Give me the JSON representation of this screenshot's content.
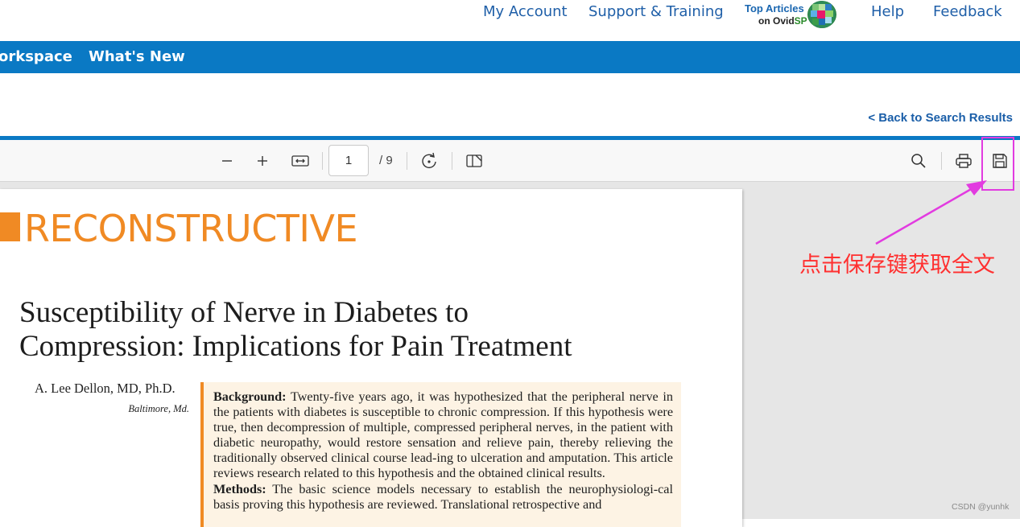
{
  "header": {
    "links": {
      "my_account": "My Account",
      "support": "Support & Training",
      "help": "Help",
      "feedback": "Feedback"
    },
    "promo": {
      "line1": "Top Articles",
      "line2_prefix": "on Ovid",
      "line2_suffix": "SP"
    }
  },
  "nav": {
    "items": [
      "orkspace",
      "What's New"
    ]
  },
  "back_link": "< Back to Search Results",
  "viewer": {
    "toolbar": {
      "zoom_out_icon": "minus-icon",
      "zoom_in_icon": "plus-icon",
      "fit_width_icon": "fit-width-icon",
      "current_page": "1",
      "page_total": "/ 9",
      "rotate_icon": "rotate-icon",
      "page_view_icon": "page-view-icon",
      "search_icon": "search-icon",
      "print_icon": "print-icon",
      "save_icon": "save-icon"
    },
    "page": {
      "section": "RECONSTRUCTIVE",
      "title_line1": "Susceptibility of Nerve in Diabetes to",
      "title_line2": "Compression: Implications for Pain Treatment",
      "author": "A. Lee Dellon, MD, Ph.D.",
      "location": "Baltimore, Md.",
      "abstract": {
        "background_label": "Background:",
        "background_text": " Twenty-five years ago, it was hypothesized that the peripheral nerve in the patients with diabetes is susceptible to chronic compression. If this hypothesis were true, then decompression of multiple, compressed peripheral nerves, in the patient with diabetic neuropathy, would restore sensation and relieve pain, thereby relieving the traditionally observed clinical course lead-ing to ulceration and amputation. This article reviews research related to this hypothesis and the obtained clinical results.",
        "methods_label": "Methods:",
        "methods_text": " The basic science models necessary to establish the neurophysiologi-cal basis proving this hypothesis are reviewed. Translational retrospective and"
      }
    }
  },
  "annotation": {
    "text": "点击保存键获取全文",
    "color": "#ff3030",
    "highlight_color": "#e23be0"
  },
  "watermark": "CSDN @yunhk",
  "colors": {
    "brand_blue": "#0a79c4",
    "link_blue": "#1f5fa8",
    "accent_orange": "#f08a24"
  }
}
